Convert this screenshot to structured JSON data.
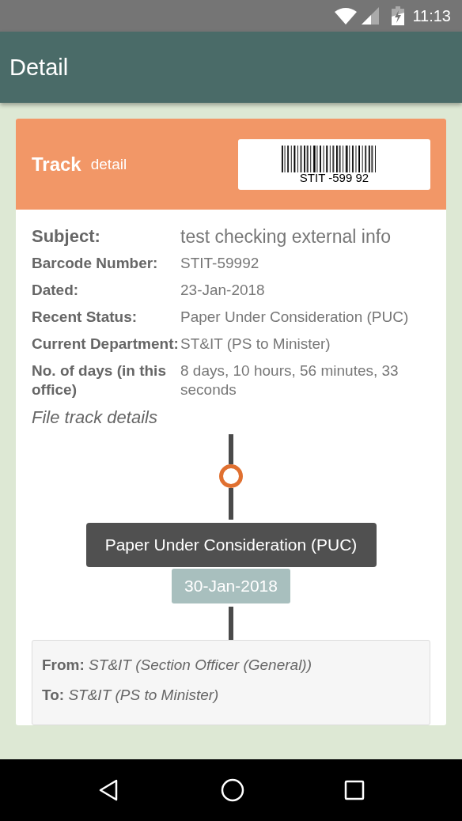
{
  "status_bar": {
    "time": "11:13"
  },
  "app_bar": {
    "title": "Detail"
  },
  "card": {
    "title": "Track",
    "subtitle": "detail",
    "barcode_text": "STIT -599 92",
    "fields": [
      {
        "label": "Subject:",
        "value": "test checking external info",
        "kind": "large"
      },
      {
        "label": "Barcode Number:",
        "value": "STIT-59992",
        "kind": "normal"
      },
      {
        "label": "Dated:",
        "value": "23-Jan-2018",
        "kind": "normal"
      },
      {
        "label": "Recent Status:",
        "value": "Paper Under Consideration (PUC)",
        "kind": "normal"
      },
      {
        "label": "Current Department:",
        "value": "ST&IT (PS to Minister)",
        "kind": "normal"
      },
      {
        "label": "No. of days (in this office)",
        "value": "8 days, 10 hours, 56 minutes, 33 seconds",
        "kind": "normal"
      }
    ],
    "track_heading": "File track details",
    "track": [
      {
        "status": "Paper Under Consideration (PUC)",
        "date": "30-Jan-2018",
        "from": "**From:** *ST&IT (Section Officer (General))*",
        "to": "**To:** *ST&IT (PS to Minister)*"
      }
    ]
  }
}
